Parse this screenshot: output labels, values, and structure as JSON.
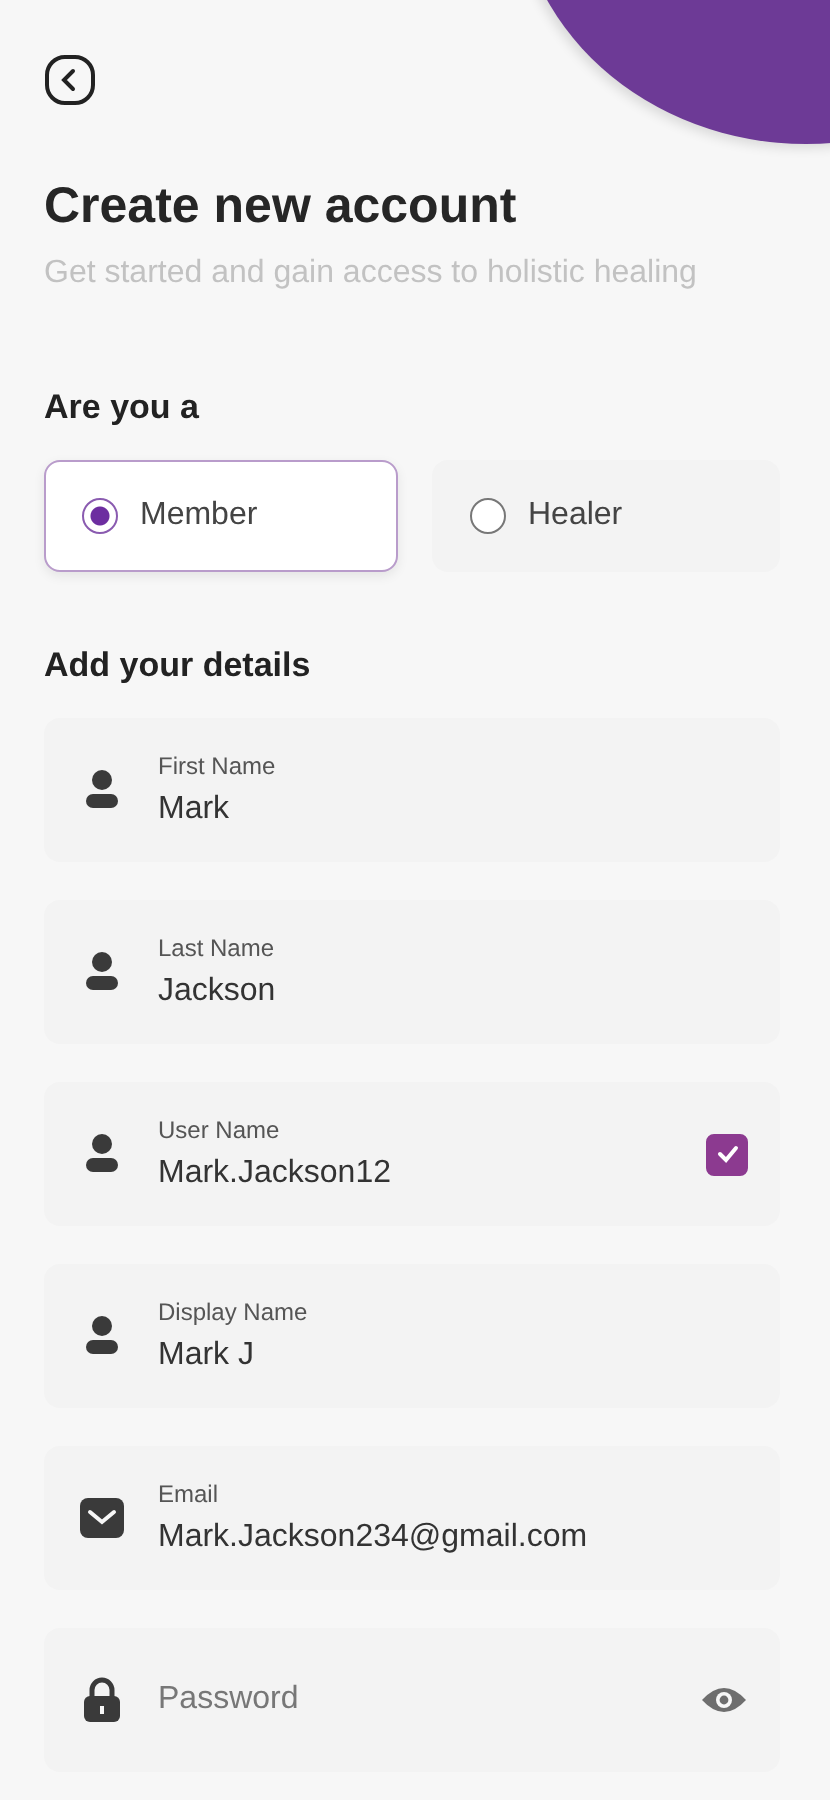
{
  "header": {
    "title": "Create new account",
    "subtitle": "Get started and gain access to holistic healing"
  },
  "role": {
    "label": "Are you a",
    "options": [
      {
        "label": "Member",
        "selected": true
      },
      {
        "label": "Healer",
        "selected": false
      }
    ]
  },
  "details": {
    "label": "Add your details",
    "fields": [
      {
        "kind": "person",
        "label": "First Name",
        "value": "Mark"
      },
      {
        "kind": "person",
        "label": "Last Name",
        "value": "Jackson"
      },
      {
        "kind": "person",
        "label": "User Name",
        "value": "Mark.Jackson12",
        "checked": true
      },
      {
        "kind": "person",
        "label": "Display Name",
        "value": "Mark J"
      },
      {
        "kind": "mail",
        "label": "Email",
        "value": "Mark.Jackson234@gmail.com"
      },
      {
        "kind": "lock",
        "placeholder": "Password"
      }
    ]
  }
}
